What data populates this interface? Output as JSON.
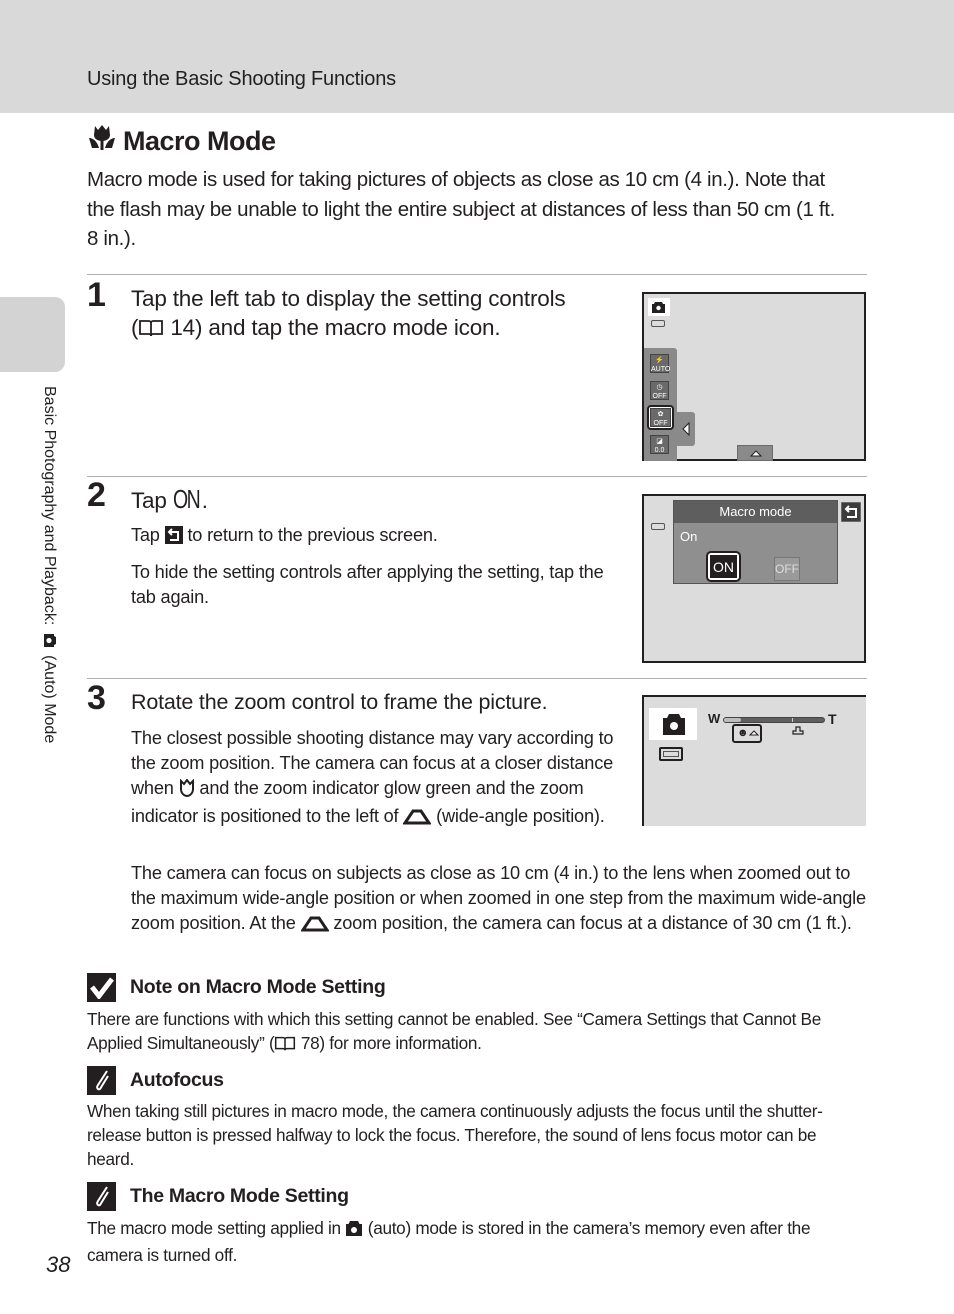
{
  "header": {
    "section_title": "Using the Basic Shooting Functions"
  },
  "sidebar": {
    "chapter_prefix": "Basic Photography and Playback:",
    "chapter_suffix": "(Auto) Mode",
    "icon": "camera-icon"
  },
  "page": {
    "number": "38"
  },
  "title": {
    "icon": "macro-tulip-icon",
    "text": "Macro Mode"
  },
  "intro": "Macro mode is used for taking pictures of objects as close as 10 cm (4 in.). Note that the flash may be unable to light the entire subject at distances of less than 50 cm (1 ft. 8 in.).",
  "steps": [
    {
      "number": "1",
      "title_line1": "Tap the left tab to display the setting controls",
      "title_line2_pre": "(",
      "title_line2_ref": "14) and tap the macro mode icon.",
      "ref_icon": "book-icon",
      "screen": {
        "mode_icon": "camera-icon",
        "battery_icon": "battery-icon",
        "controls": [
          {
            "icon": "flash-icon",
            "label": "AUTO"
          },
          {
            "icon": "self-timer-icon",
            "label": "OFF"
          },
          {
            "icon": "macro-icon",
            "label": "OFF",
            "selected": true
          },
          {
            "icon": "exposure-comp-icon",
            "label": "0.0"
          }
        ],
        "tab_icon": "chevron-left-icon",
        "bottom_tab_icon": "chevron-up-icon"
      }
    },
    {
      "number": "2",
      "title_pre": "Tap",
      "title_glyph": "ON",
      "title_post": ".",
      "body": [
        {
          "pre": "Tap",
          "icon": "return-icon",
          "post": "to return to the previous screen."
        },
        {
          "text": "To hide the setting controls after applying the setting, tap the tab again."
        }
      ],
      "screen": {
        "menu_title": "Macro mode",
        "current_value": "On",
        "options": [
          {
            "label": "ON",
            "selected": true
          },
          {
            "label": "OFF",
            "selected": false
          }
        ],
        "battery_icon": "battery-icon",
        "return_icon": "return-icon"
      }
    },
    {
      "number": "3",
      "title": "Rotate the zoom control to frame the picture.",
      "body_p1_a": "The closest possible shooting distance may vary according to the zoom position. The camera can focus at a closer distance when",
      "body_p1_b": "and the zoom indicator glow green and the zoom indicator is positioned to the left of",
      "body_p1_c": "(wide-angle position).",
      "body_p2_a": "The camera can focus on subjects as close as 10 cm (4 in.) to the lens when zoomed out to the maximum wide-angle position or when zoomed in one step from the maximum wide-angle zoom position. At the",
      "body_p2_b": "zoom position, the camera can focus at a distance of 30 cm (1 ft.).",
      "screen": {
        "zoom_wide_label": "W",
        "zoom_tele_label": "T",
        "zoom_position_fraction": 0.17,
        "mode_icon": "camera-icon",
        "battery_icon": "battery-icon"
      }
    }
  ],
  "notes": [
    {
      "icon": "checkmark-icon",
      "title": "Note on Macro Mode Setting",
      "body_a": "There are functions with which this setting cannot be enabled. See “Camera Settings that Cannot Be Applied Simultaneously” (",
      "body_b": "78) for more information."
    },
    {
      "icon": "pencil-icon",
      "title": "Autofocus",
      "body": "When taking still pictures in macro mode, the camera continuously adjusts the focus until the shutter-release button is pressed halfway to lock the focus. Therefore, the sound of lens focus motor can be heard."
    },
    {
      "icon": "pencil-icon",
      "title": "The Macro Mode Setting",
      "body_a": "The macro mode setting applied in",
      "body_b": "(auto) mode is stored in the camera’s memory even after the camera is turned off."
    }
  ]
}
